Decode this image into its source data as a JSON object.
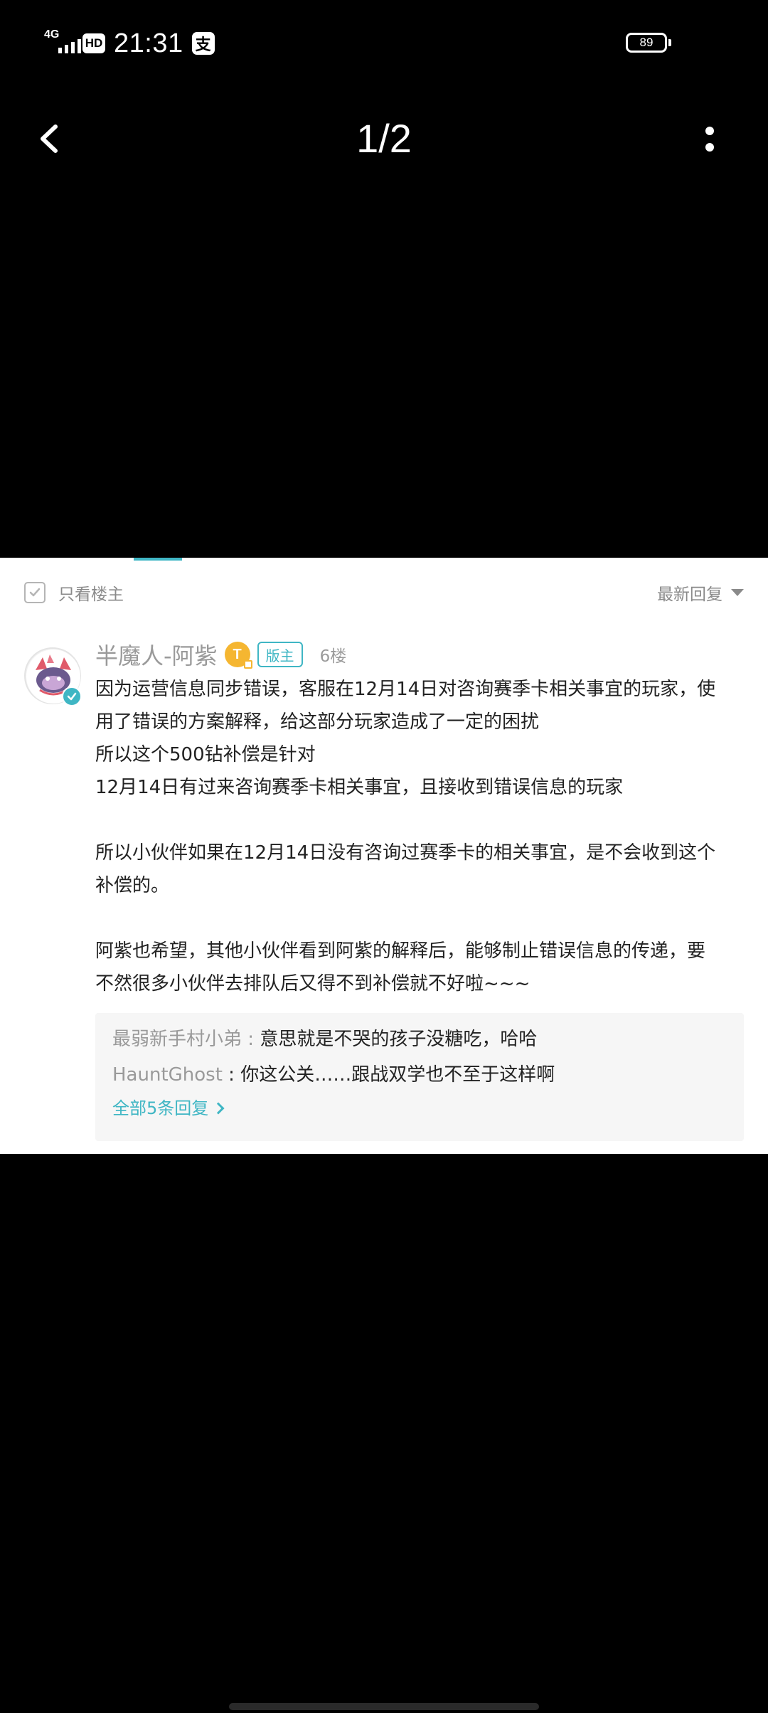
{
  "status_bar": {
    "network": "4G",
    "hd": "HD",
    "time": "21:31",
    "app_glyph": "支",
    "battery": "89"
  },
  "nav": {
    "page_indicator": "1/2",
    "back_icon": "chevron-left-icon",
    "more_icon": "more-vertical-icon"
  },
  "filter": {
    "only_op_label": "只看楼主",
    "sort_label": "最新回复"
  },
  "post": {
    "author": "半魔人-阿紫",
    "level_badge": "T",
    "role_badge": "版主",
    "floor": "6楼",
    "paragraphs": [
      "因为运营信息同步错误，客服在12月14日对咨询赛季卡相关事宜的玩家，使",
      "用了错误的方案解释，给这部分玩家造成了一定的困扰",
      "所以这个500钻补偿是针对",
      "12月14日有过来咨询赛季卡相关事宜，且接收到错误信息的玩家",
      "",
      "所以小伙伴如果在12月14日没有咨询过赛季卡的相关事宜，是不会收到这个",
      "补偿的。",
      "",
      "阿紫也希望，其他小伙伴看到阿紫的解释后，能够制止错误信息的传递，要",
      "不然很多小伙伴去排队后又得不到补偿就不好啦~~~"
    ]
  },
  "replies": {
    "items": [
      {
        "author": "最弱新手村小弟",
        "separator": " : ",
        "text": "意思就是不哭的孩子没糖吃，哈哈"
      },
      {
        "author": "HauntGhost",
        "separator": " : ",
        "text": "你这公关……跟战双学也不至于这样啊"
      }
    ],
    "view_all": "全部5条回复"
  },
  "colors": {
    "accent": "#3fb6c4",
    "level_gold": "#f5b631",
    "muted": "#9a9a9a",
    "text": "#222222"
  }
}
